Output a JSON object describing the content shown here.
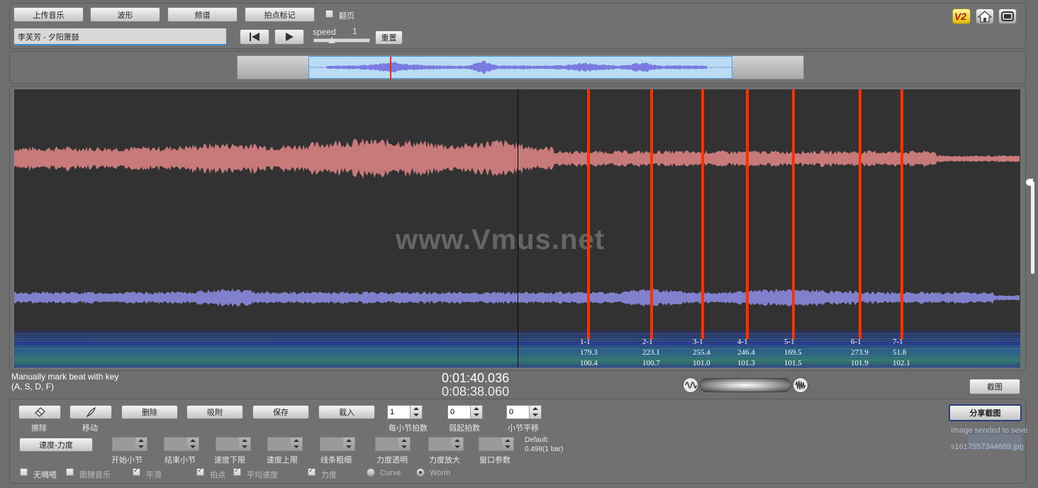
{
  "top": {
    "buttons": [
      "上传音乐",
      "波形",
      "频谱",
      "拍点标记"
    ],
    "flip_label": "翻页",
    "song_title": "李芙芳 - 夕阳箫鼓",
    "speed_label": "speed",
    "speed_value": "1",
    "reset_label": "重置",
    "corner_badge": "V2"
  },
  "waveform": {
    "watermark": "www.Vmus.net",
    "beats": [
      {
        "label": "1-1",
        "v1": "179.3",
        "v2": "100.4"
      },
      {
        "label": "2-1",
        "v1": "223.1",
        "v2": "100.7"
      },
      {
        "label": "3-1",
        "v1": "255.4",
        "v2": "101.0"
      },
      {
        "label": "4-1",
        "v1": "246.4",
        "v2": "101.3"
      },
      {
        "label": "5-1",
        "v1": "169.5",
        "v2": "101.5"
      },
      {
        "label": "6-1",
        "v1": "273.9",
        "v2": "101.9"
      },
      {
        "label": "7-1",
        "v1": "51.8",
        "v2": "102.1"
      }
    ]
  },
  "status": {
    "hint_line1": "Manually mark beat with key",
    "hint_line2": "(A, S, D, F)",
    "current_time": "0:01:40.036",
    "total_time": "0:08:38.060",
    "screenshot_label": "截图"
  },
  "bottom": {
    "tools": [
      "擦除",
      "移动"
    ],
    "actions": [
      "删除",
      "吸附",
      "保存",
      "载入"
    ],
    "beats_per_bar": {
      "value": "1",
      "label": "每小节拍数"
    },
    "weak_beats": {
      "value": "0",
      "label": "弱起拍数"
    },
    "bar_shift": {
      "value": "0",
      "label": "小节平移"
    },
    "tempo_button": "速度-力度",
    "params": [
      "开始小节",
      "结束小节",
      "速度下限",
      "速度上限",
      "线条粗细",
      "力度透明",
      "力度放大",
      "窗口参数"
    ],
    "default_line1": "Default:",
    "default_line2": "0.498(1 bar)",
    "options": {
      "no_mouse": "无嘀嗒",
      "follow_music": "跟随音乐",
      "smooth": "平滑",
      "beat": "拍点",
      "avg_speed": "平均速度",
      "force": "力度",
      "curve": "Curve",
      "worm": "Worm"
    },
    "share_button": "分享截图",
    "share_msg1": "Image sended to seve",
    "share_msg2": "s1617557344689.jpg"
  }
}
